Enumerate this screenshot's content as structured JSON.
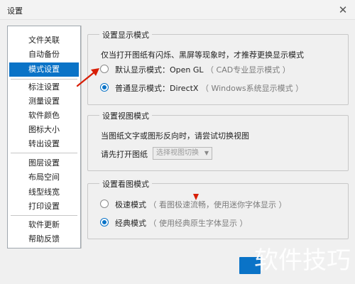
{
  "window": {
    "title": "设置",
    "close_icon": "close-icon"
  },
  "sidebar": {
    "items": [
      {
        "label": "文件关联"
      },
      {
        "label": "自动备份"
      },
      {
        "label": "模式设置",
        "active": true
      },
      {
        "label": "标注设置"
      },
      {
        "label": "测量设置"
      },
      {
        "label": "软件颜色"
      },
      {
        "label": "图标大小"
      },
      {
        "label": "转出设置"
      },
      {
        "label": "图层设置"
      },
      {
        "label": "布局空间"
      },
      {
        "label": "线型线宽"
      },
      {
        "label": "打印设置"
      },
      {
        "label": "软件更新"
      },
      {
        "label": "帮助反馈"
      }
    ]
  },
  "display_mode": {
    "title": "设置显示模式",
    "description": "仅当打开图纸有闪烁、黑屏等现象时，才推荐更换显示模式",
    "options": [
      {
        "label": "默认显示模式：Open GL",
        "hint": "（ CAD专业显示模式 ）",
        "checked": false
      },
      {
        "label": "普通显示模式：DirectX",
        "hint": "（ Windows系统显示模式 ）",
        "checked": true
      }
    ]
  },
  "view_mode": {
    "title": "设置视图模式",
    "description": "当图纸文字或图形反向时，请尝试切换视图",
    "prompt": "请先打开图纸",
    "select_value": "选择视图切换"
  },
  "viewing_mode": {
    "title": "设置看图模式",
    "options": [
      {
        "label": "极速模式",
        "hint": "（ 看图极速流畅，使用迷你字体显示 ）",
        "checked": false
      },
      {
        "label": "经典模式",
        "hint": "（ 使用经典原生字体显示 ）",
        "checked": true
      }
    ]
  },
  "watermark": "软件技巧",
  "colors": {
    "accent": "#0a73c7",
    "annotation": "#d81e06"
  }
}
